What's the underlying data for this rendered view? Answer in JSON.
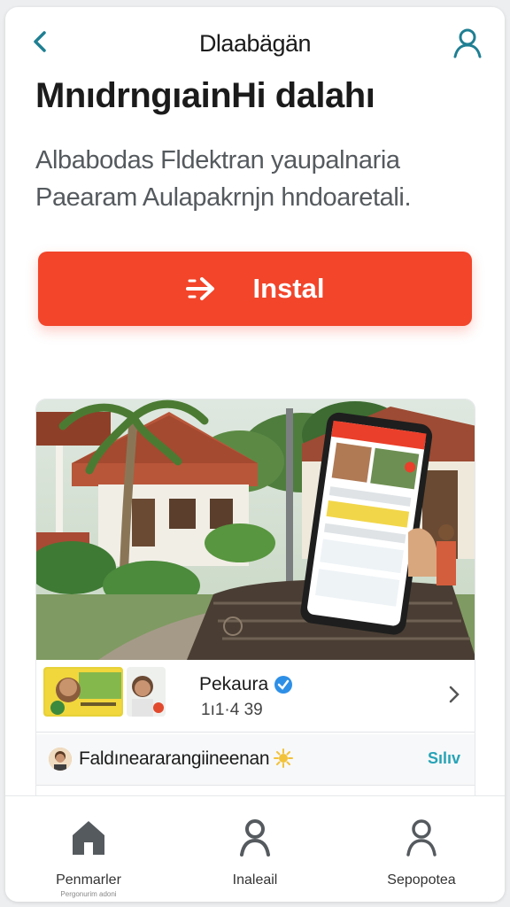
{
  "header": {
    "title": "Dlaabägän",
    "back_icon": "chevron-left-icon",
    "profile_icon": "user-icon"
  },
  "page": {
    "title": "MnıdrngıainHi dalahı",
    "description": "Albabodas Fldektran yaupalnaria Paearam Aulapakrnjn hndoaretali."
  },
  "install": {
    "label": "Instal",
    "icon": "arrow-right-icon"
  },
  "feature": {
    "post": {
      "name": "Pekaura",
      "meta": "1ı1·4 39"
    },
    "comment": {
      "text": "Faldıneararangiineenan",
      "action": "Sılıv"
    }
  },
  "nav": {
    "items": [
      {
        "label": "Penmarler",
        "sub": "Pergonurim adoni",
        "icon": "home-icon"
      },
      {
        "label": "Inaleail",
        "sub": "",
        "icon": "user-icon"
      },
      {
        "label": "Sepopotea",
        "sub": "",
        "icon": "user-icon"
      }
    ]
  },
  "colors": {
    "accent": "#f2452a",
    "header_icon": "#1f7f93",
    "verified": "#2e8fe6",
    "link": "#27a3b7"
  }
}
